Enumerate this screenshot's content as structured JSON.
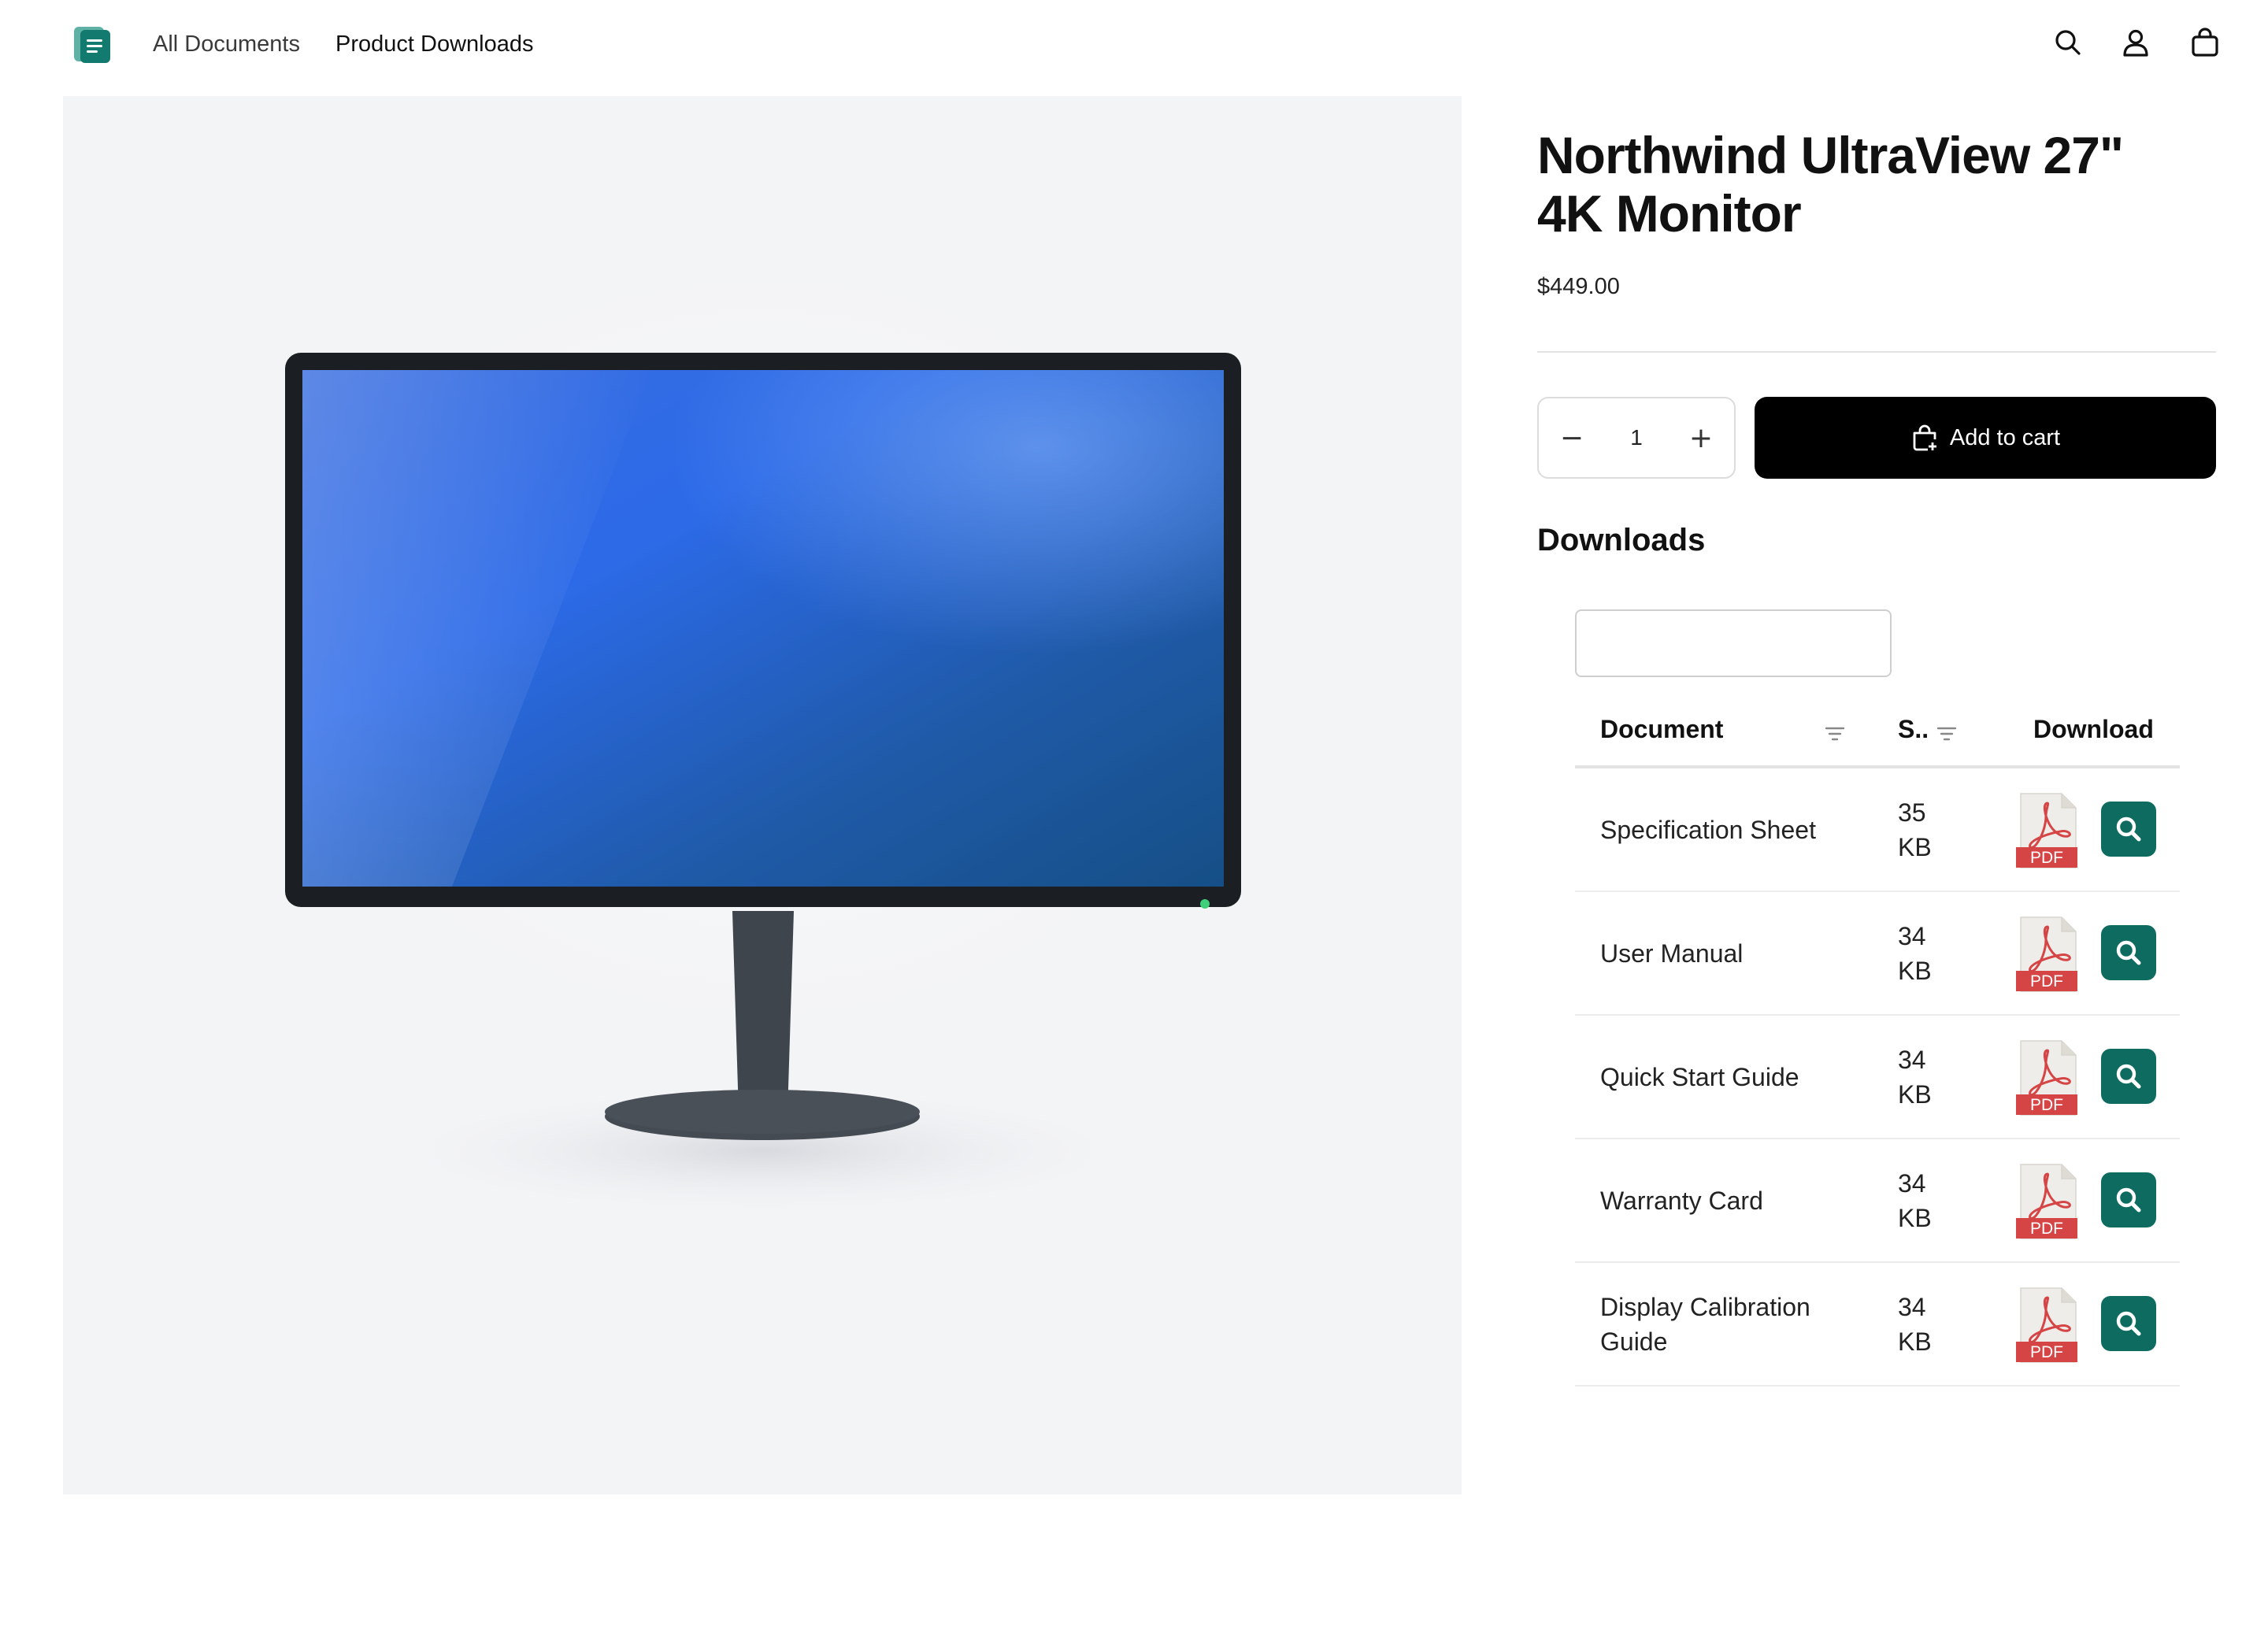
{
  "header": {
    "nav": [
      {
        "label": "All Documents"
      },
      {
        "label": "Product Downloads"
      }
    ],
    "icons": [
      "search-icon",
      "account-icon",
      "cart-icon"
    ]
  },
  "product": {
    "title": "Northwind UltraView 27\" 4K Monitor",
    "price": "$449.00",
    "quantity": "1",
    "add_to_cart_label": "Add to cart"
  },
  "downloads": {
    "heading": "Downloads",
    "search_placeholder": "",
    "columns": {
      "document": "Document",
      "size": "S..",
      "download": "Download"
    },
    "rows": [
      {
        "document": "Specification Sheet",
        "size": "35\nKB",
        "type_label": "PDF"
      },
      {
        "document": "User Manual",
        "size": "34\nKB",
        "type_label": "PDF"
      },
      {
        "document": "Quick Start Guide",
        "size": "34\nKB",
        "type_label": "PDF"
      },
      {
        "document": "Warranty Card",
        "size": "34\nKB",
        "type_label": "PDF"
      },
      {
        "document": "Display Calibration Guide",
        "size": "34\nKB",
        "type_label": "PDF"
      }
    ]
  },
  "colors": {
    "accent": "#0d6b5f",
    "button_dark": "#000000",
    "pdf_red": "#d64545",
    "media_bg": "#f3f4f6"
  }
}
